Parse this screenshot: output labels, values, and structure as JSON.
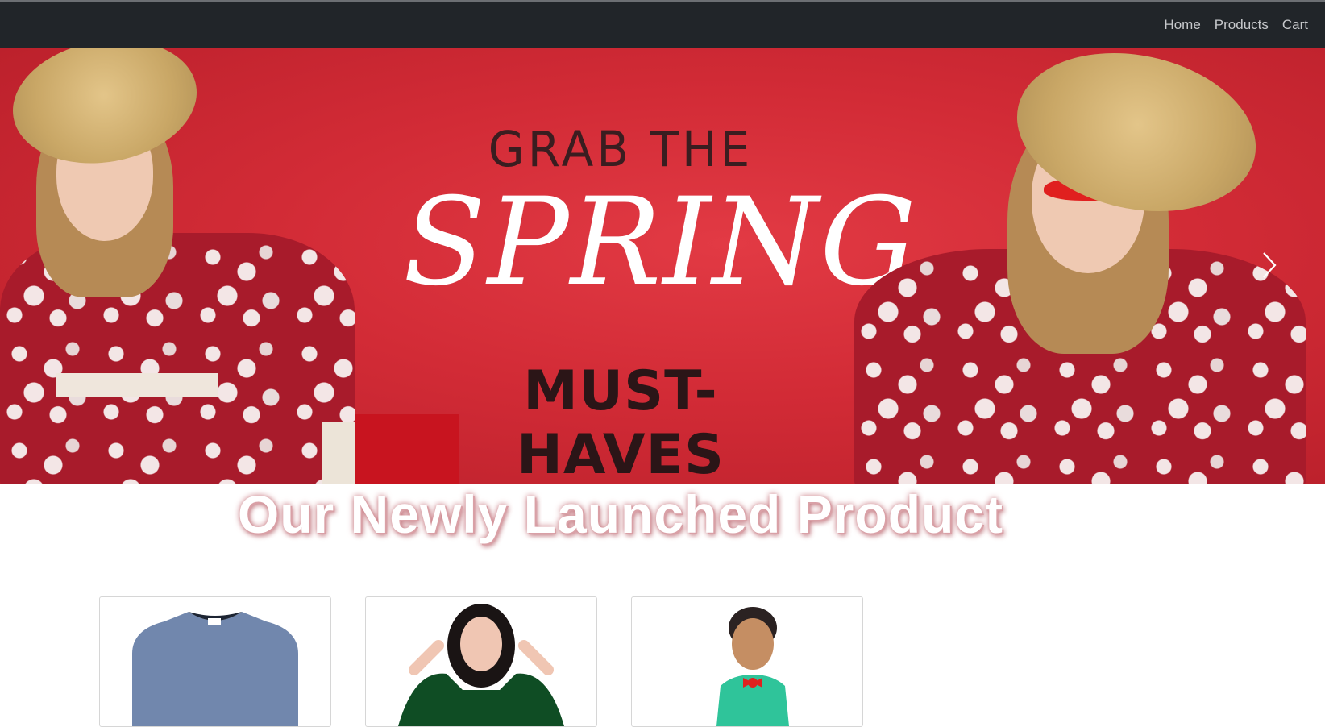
{
  "navbar": {
    "links": [
      "Home",
      "Products",
      "Cart"
    ]
  },
  "carousel": {
    "slide_headline": "GRAB THE",
    "slide_title": "SPRING",
    "slide_subtitle": "MUST-HAVES",
    "slide_count": 3,
    "active_slide": 3
  },
  "section": {
    "title": "Our Newly Launched Product"
  },
  "products": [
    {
      "image": "blue-sweatshirt"
    },
    {
      "image": "green-off-shoulder-dress"
    },
    {
      "image": "kids-green-shirt"
    }
  ],
  "colors": {
    "navbar_bg": "#212529",
    "banner_red": "#d22b36",
    "heading_shadow": "#d9a0a6"
  }
}
